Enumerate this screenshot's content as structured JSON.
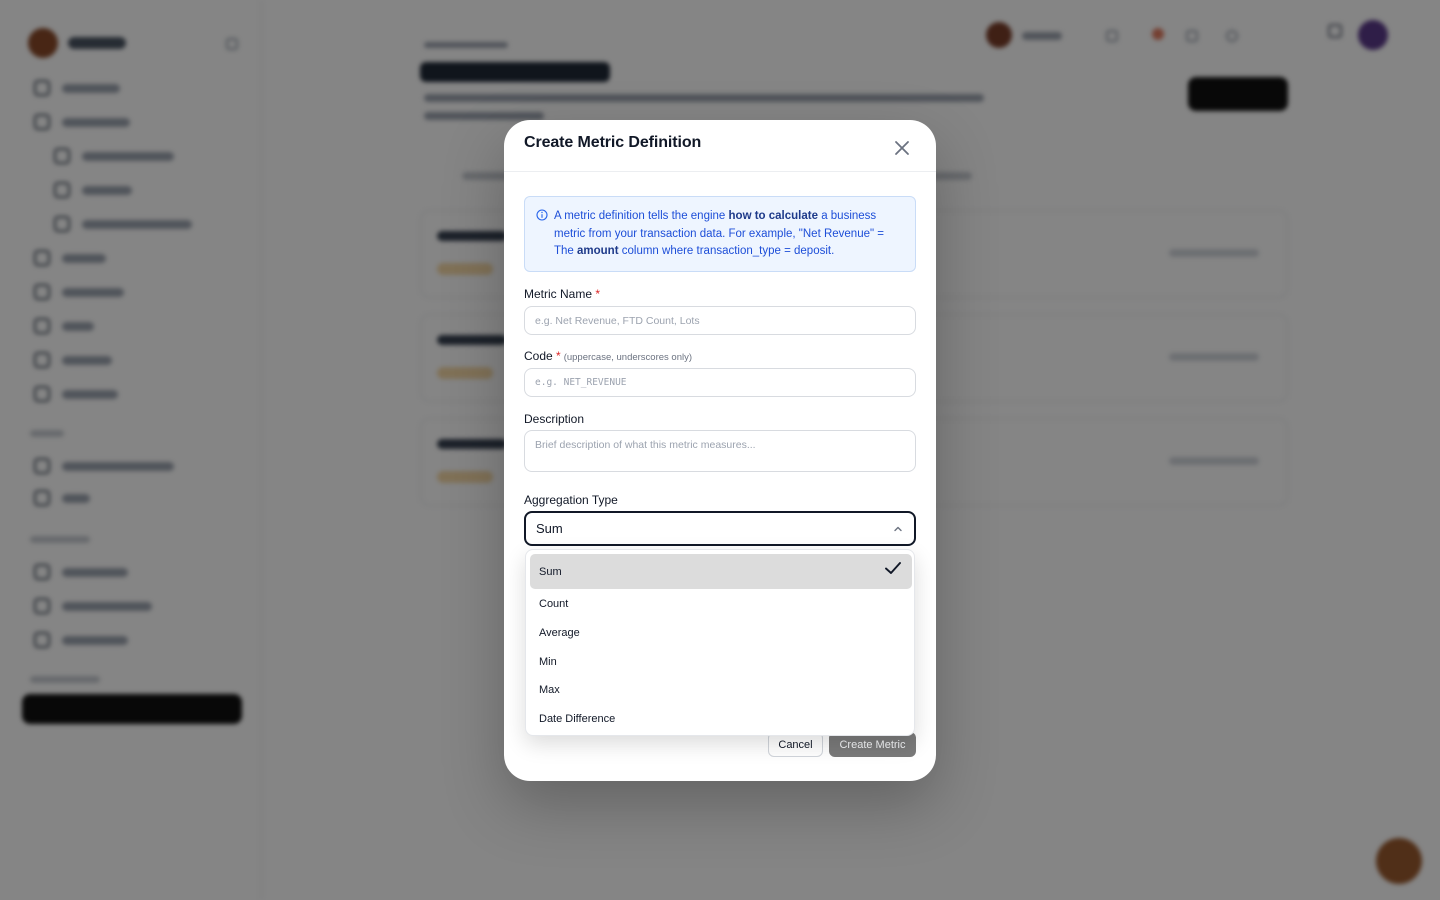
{
  "modal": {
    "title": "Create Metric Definition",
    "info": {
      "part1": "A metric definition tells the engine ",
      "bold1": "how to calculate",
      "part2": " a business metric from your transaction data. For example, \"Net Revenue\" = The ",
      "bold2": "amount",
      "part3": " column where transaction_type = deposit."
    },
    "fields": {
      "metric_name": {
        "label": "Metric Name",
        "required_mark": "*",
        "placeholder": "e.g. Net Revenue, FTD Count, Lots"
      },
      "code": {
        "label": "Code",
        "required_mark": "*",
        "hint": "(uppercase, underscores only)",
        "placeholder": "e.g. NET_REVENUE"
      },
      "description": {
        "label": "Description",
        "placeholder": "Brief description of what this metric measures..."
      },
      "aggregation": {
        "label": "Aggregation Type",
        "value": "Sum",
        "options": [
          "Sum",
          "Count",
          "Average",
          "Min",
          "Max",
          "Date Difference"
        ]
      }
    },
    "buttons": {
      "cancel": "Cancel",
      "create": "Create Metric"
    }
  },
  "colors": {
    "accent": "#111827",
    "info_text": "#1d4ed8",
    "info_bg": "#eef5ff",
    "required": "#dc2626",
    "disabled_button": "#7a7a7a"
  }
}
